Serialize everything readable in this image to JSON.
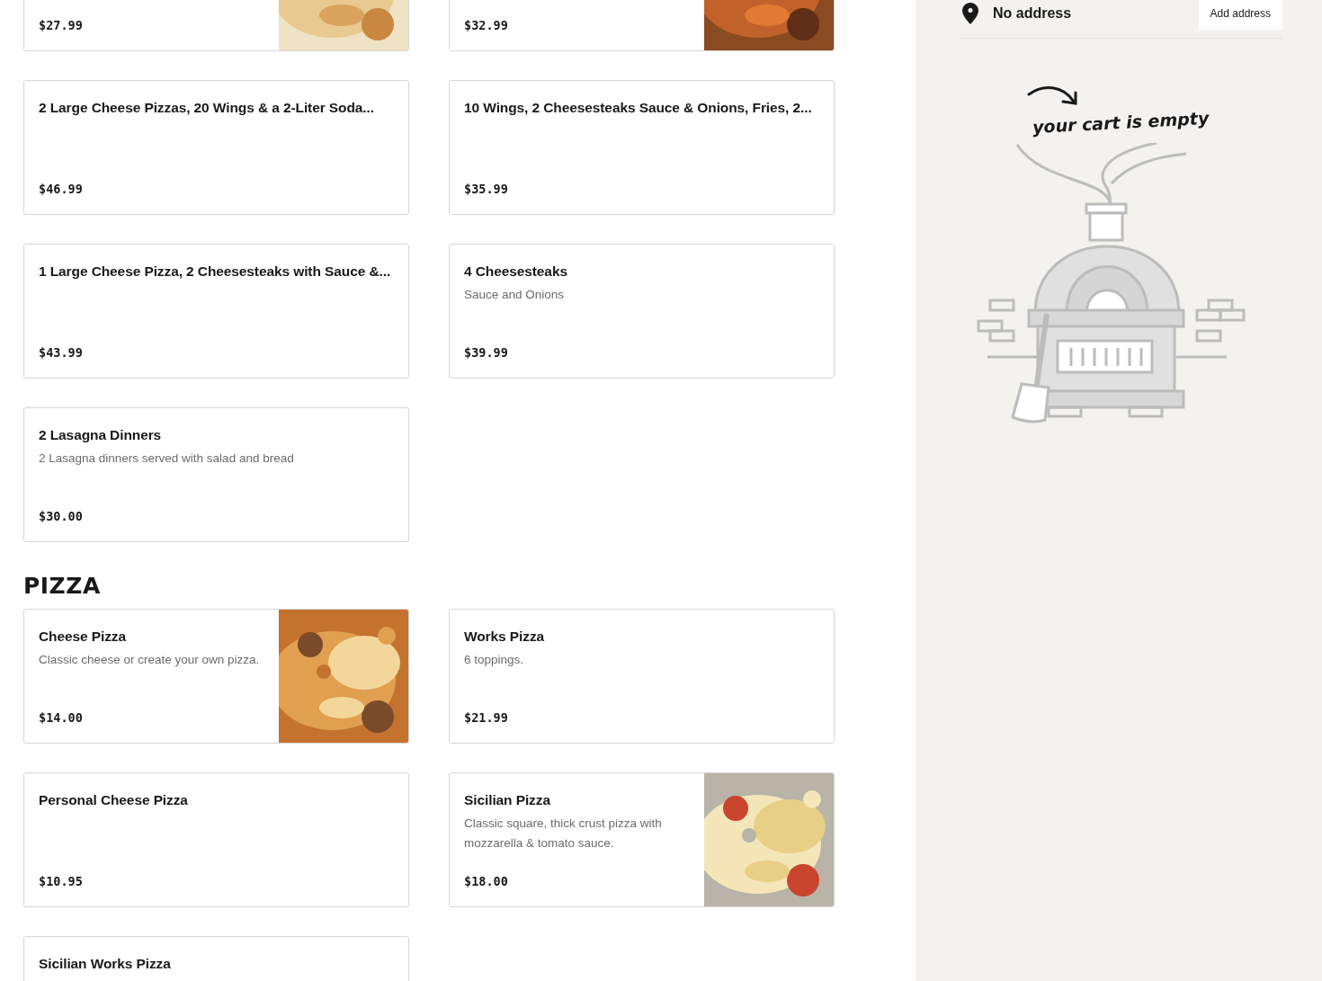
{
  "sections": [
    {
      "items": [
        {
          "price": "$27.99"
        },
        {
          "price": "$32.99"
        },
        {
          "title": "2 Large Cheese Pizzas, 20 Wings & a 2-Liter Soda...",
          "price": "$46.99"
        },
        {
          "title": "10 Wings, 2 Cheesesteaks Sauce & Onions, Fries, 2...",
          "price": "$35.99"
        },
        {
          "title": "1 Large Cheese Pizza, 2 Cheesesteaks with Sauce &...",
          "price": "$43.99"
        },
        {
          "title": "4 Cheesesteaks",
          "description": "Sauce and Onions",
          "price": "$39.99"
        },
        {
          "title": "2 Lasagna Dinners",
          "description": "2 Lasagna dinners served with salad and bread",
          "price": "$30.00"
        }
      ]
    },
    {
      "title": "PIZZA",
      "items": [
        {
          "title": "Cheese Pizza",
          "description": "Classic cheese or create your own pizza.",
          "price": "$14.00"
        },
        {
          "title": "Works Pizza",
          "description": "6 toppings.",
          "price": "$21.99"
        },
        {
          "title": "Personal Cheese Pizza",
          "price": "$10.95"
        },
        {
          "title": "Sicilian Pizza",
          "description": "Classic square, thick crust pizza with mozzarella & tomato sauce.",
          "price": "$18.00"
        },
        {
          "title": "Sicilian Works Pizza"
        }
      ]
    }
  ],
  "cart": {
    "address": "No address",
    "add_button": "Add address",
    "empty_message": "your cart is empty"
  }
}
